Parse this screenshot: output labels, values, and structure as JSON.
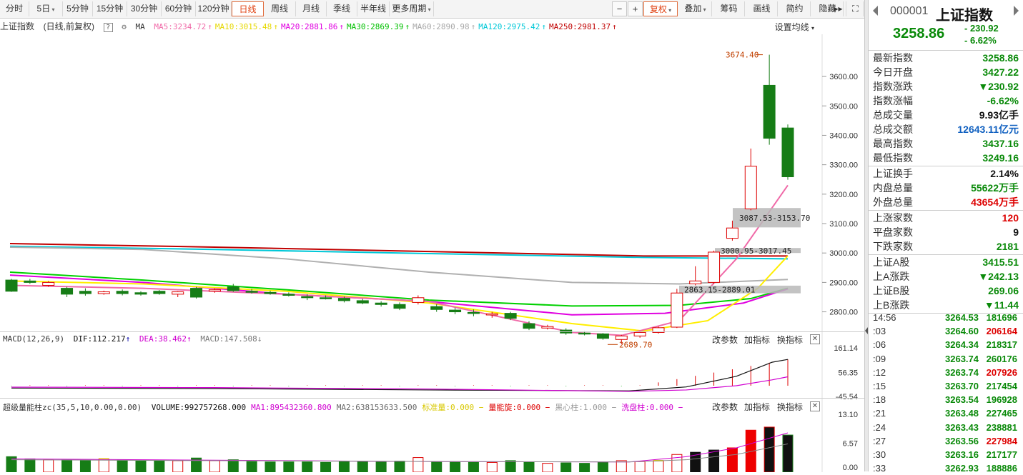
{
  "toolbar": {
    "periods": [
      "分时",
      "5日",
      "5分钟",
      "15分钟",
      "30分钟",
      "60分钟",
      "120分钟",
      "日线",
      "周线",
      "月线",
      "季线",
      "半年线",
      "更多周期"
    ],
    "active": "日线",
    "minus": "−",
    "plus": "+",
    "fuquan": "复权",
    "overlay": "叠加",
    "tools": [
      "筹码",
      "画线",
      "简约",
      "隐藏"
    ],
    "more": "▸▸",
    "expand": "⛶"
  },
  "chart_header": {
    "title": "上证指数",
    "subtitle": "(日线,前复权)",
    "help": "?",
    "ma_label": "MA",
    "ma_items": [
      {
        "text": "MA5:3234.72",
        "color": "#f06aa8"
      },
      {
        "text": "MA10:3015.48",
        "color": "#e6d800"
      },
      {
        "text": "MA20:2881.86",
        "color": "#e000e0"
      },
      {
        "text": "MA30:2869.39",
        "color": "#00c000"
      },
      {
        "text": "MA60:2890.98",
        "color": "#a8a8a8"
      },
      {
        "text": "MA120:2975.42",
        "color": "#00c8d8"
      },
      {
        "text": "MA250:2981.37",
        "color": "#c00000"
      }
    ],
    "settings": "设置均线"
  },
  "annotations": {
    "high": "3674.40",
    "gap1": "3087.53-3153.70",
    "gap2": "3000.95-3017.45",
    "gap3": "2863.15-2889.01",
    "low": "2689.70"
  },
  "chart_data": [
    {
      "type": "candlestick",
      "y_ticks": [
        "3600.00",
        "3500.00",
        "3400.00",
        "3300.00",
        "3200.00",
        "3100.00",
        "3000.00",
        "2900.00",
        "2800.00"
      ],
      "ylim": [
        2680,
        3690
      ],
      "candles": [
        [
          2908,
          2870,
          2912,
          2868
        ],
        [
          2905,
          2900,
          2912,
          2895
        ],
        [
          2890,
          2900,
          2905,
          2885
        ],
        [
          2880,
          2860,
          2885,
          2850
        ],
        [
          2870,
          2862,
          2880,
          2855
        ],
        [
          2862,
          2868,
          2872,
          2858
        ],
        [
          2870,
          2862,
          2876,
          2856
        ],
        [
          2865,
          2860,
          2870,
          2855
        ],
        [
          2870,
          2862,
          2874,
          2858
        ],
        [
          2860,
          2868,
          2870,
          2850
        ],
        [
          2880,
          2850,
          2885,
          2845
        ],
        [
          2870,
          2875,
          2880,
          2865
        ],
        [
          2885,
          2872,
          2895,
          2868
        ],
        [
          2870,
          2868,
          2878,
          2862
        ],
        [
          2866,
          2862,
          2872,
          2858
        ],
        [
          2860,
          2856,
          2866,
          2852
        ],
        [
          2852,
          2848,
          2860,
          2840
        ],
        [
          2848,
          2846,
          2856,
          2842
        ],
        [
          2846,
          2838,
          2852,
          2832
        ],
        [
          2838,
          2830,
          2844,
          2826
        ],
        [
          2830,
          2825,
          2836,
          2818
        ],
        [
          2825,
          2812,
          2832,
          2806
        ],
        [
          2832,
          2848,
          2856,
          2825
        ],
        [
          2818,
          2808,
          2826,
          2800
        ],
        [
          2806,
          2800,
          2814,
          2792
        ],
        [
          2798,
          2795,
          2808,
          2785
        ],
        [
          2790,
          2793,
          2800,
          2780
        ],
        [
          2795,
          2778,
          2800,
          2772
        ],
        [
          2760,
          2744,
          2768,
          2738
        ],
        [
          2745,
          2750,
          2756,
          2740
        ],
        [
          2738,
          2728,
          2744,
          2722
        ],
        [
          2728,
          2726,
          2734,
          2720
        ],
        [
          2725,
          2710,
          2728,
          2705
        ],
        [
          2706,
          2718,
          2722,
          2690
        ],
        [
          2718,
          2730,
          2734,
          2712
        ],
        [
          2730,
          2746,
          2750,
          2726
        ],
        [
          2748,
          2864,
          2878,
          2745
        ],
        [
          2895,
          2905,
          2955,
          2890
        ],
        [
          2900,
          3003,
          3008,
          2895
        ],
        [
          3050,
          3085,
          3110,
          3042
        ],
        [
          3150,
          3295,
          3355,
          3145
        ],
        [
          3570,
          3390,
          3674,
          3368
        ],
        [
          3425,
          3259,
          3437,
          3249
        ]
      ]
    },
    {
      "type": "bar",
      "name": "MACD",
      "params": "MACD(12,26,9)",
      "dif": "DIF:112.217",
      "dea": "DEA:38.462",
      "macd": "MACD:147.508",
      "y_ticks": [
        "161.14",
        "56.35",
        "-45.54"
      ]
    },
    {
      "type": "bar",
      "name": "超级量能柱",
      "params": "超级量能柱zc(35,5,10,0.00,0.00)",
      "items": [
        {
          "text": "VOLUME:992757268.000",
          "color": "#111"
        },
        {
          "text": "MA1:895432360.800",
          "color": "#d000d0"
        },
        {
          "text": "MA2:638153633.500",
          "color": "#666"
        },
        {
          "text": "标准量:0.000 −",
          "color": "#d8c800"
        },
        {
          "text": "量能旋:0.000 −",
          "color": "#d00"
        },
        {
          "text": "黑心柱:1.000 −",
          "color": "#999"
        },
        {
          "text": "洗盘柱:0.000 −",
          "color": "#d000d0"
        }
      ],
      "y_ticks": [
        "13.10",
        "6.57",
        "0.00"
      ]
    }
  ],
  "sub_buttons": [
    "改参数",
    "加指标",
    "换指标"
  ],
  "close": "✕",
  "panel": {
    "code": "000001",
    "name": "上证指数",
    "price": "3258.86",
    "change": "- 230.92",
    "change_pct": "- 6.62%",
    "rows1": [
      {
        "k": "最新指数",
        "v": "3258.86",
        "c": "g"
      },
      {
        "k": "今日开盘",
        "v": "3427.22",
        "c": "g"
      },
      {
        "k": "指数涨跌",
        "v": "▼230.92",
        "c": "g"
      },
      {
        "k": "指数涨幅",
        "v": "-6.62%",
        "c": "g"
      },
      {
        "k": "总成交量",
        "v": "9.93亿手",
        "c": "blk"
      },
      {
        "k": "总成交额",
        "v": "12643.11亿元",
        "c": "b"
      },
      {
        "k": "最高指数",
        "v": "3437.16",
        "c": "g"
      },
      {
        "k": "最低指数",
        "v": "3249.16",
        "c": "g"
      }
    ],
    "rows2": [
      {
        "k": "上证换手",
        "v": "2.14%",
        "c": "blk"
      },
      {
        "k": "内盘总量",
        "v": "55622万手",
        "c": "g"
      },
      {
        "k": "外盘总量",
        "v": "43654万手",
        "c": "r"
      }
    ],
    "rows3": [
      {
        "k": "上涨家数",
        "v": "120",
        "c": "r"
      },
      {
        "k": "平盘家数",
        "v": "9",
        "c": "blk"
      },
      {
        "k": "下跌家数",
        "v": "2181",
        "c": "g"
      }
    ],
    "rows4": [
      {
        "k": "上证A股",
        "v": "3415.51",
        "c": "g"
      },
      {
        "k": "上A涨跌",
        "v": "▼242.13",
        "c": "g"
      },
      {
        "k": "上证B股",
        "v": "269.06",
        "c": "g"
      },
      {
        "k": "上B涨跌",
        "v": "▼11.44",
        "c": "g"
      }
    ],
    "ticks": [
      {
        "t": "14:56",
        "p": "3264.53",
        "v": "181696",
        "c": "g"
      },
      {
        "t": ":03",
        "p": "3264.60",
        "v": "206164",
        "c": "r"
      },
      {
        "t": ":06",
        "p": "3264.34",
        "v": "218317",
        "c": "g"
      },
      {
        "t": ":09",
        "p": "3263.74",
        "v": "260176",
        "c": "g"
      },
      {
        "t": ":12",
        "p": "3263.74",
        "v": "207926",
        "c": "r"
      },
      {
        "t": ":15",
        "p": "3263.70",
        "v": "217454",
        "c": "g"
      },
      {
        "t": ":18",
        "p": "3263.54",
        "v": "196928",
        "c": "g"
      },
      {
        "t": ":21",
        "p": "3263.48",
        "v": "227465",
        "c": "g"
      },
      {
        "t": ":24",
        "p": "3263.43",
        "v": "238881",
        "c": "g"
      },
      {
        "t": ":27",
        "p": "3263.56",
        "v": "227984",
        "c": "r"
      },
      {
        "t": ":30",
        "p": "3263.16",
        "v": "217177",
        "c": "g"
      },
      {
        "t": ":33",
        "p": "3262.93",
        "v": "188886",
        "c": "g"
      }
    ]
  }
}
